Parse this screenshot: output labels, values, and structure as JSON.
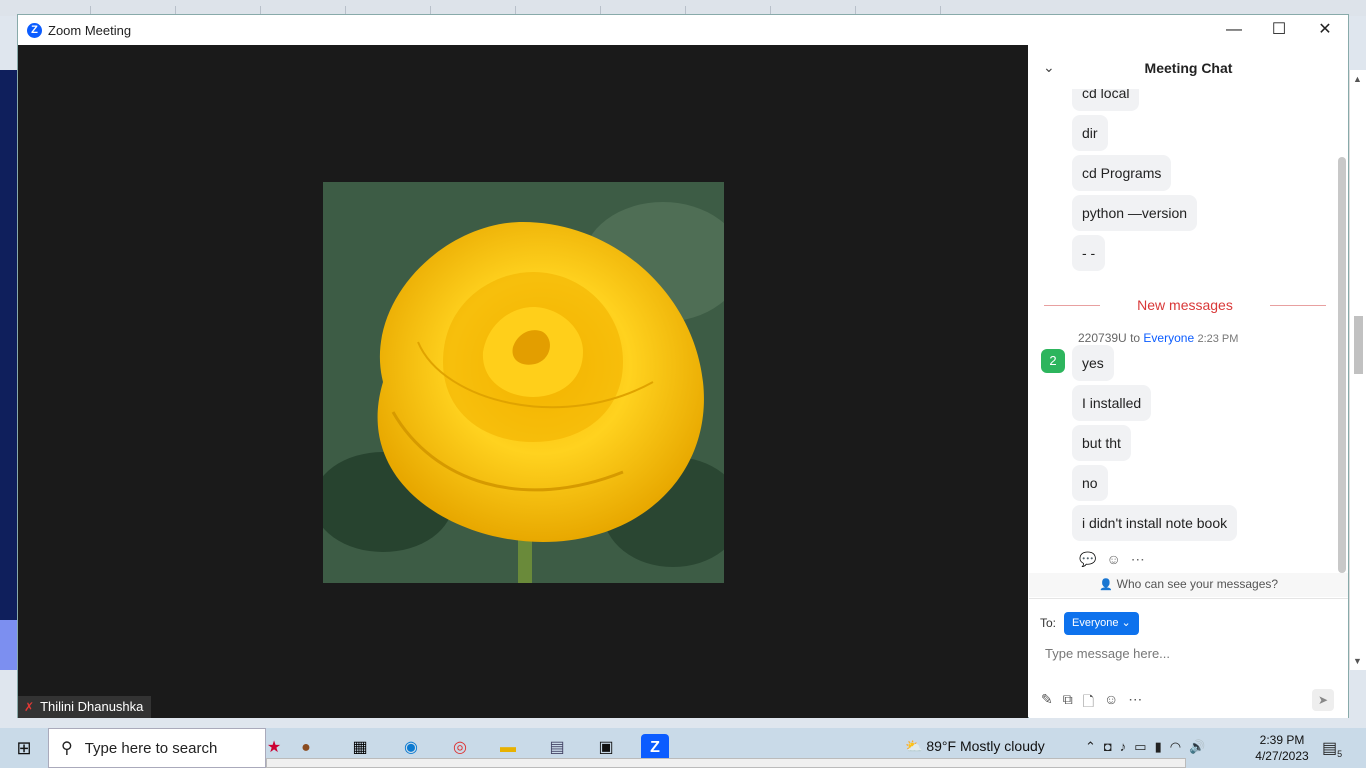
{
  "window": {
    "title": "Zoom Meeting",
    "logo_letter": "Z",
    "minimize": "—",
    "maximize": "☐",
    "close": "✕"
  },
  "video": {
    "participant_name": "Thilini Dhanushka",
    "shared_content": "yellow rose image"
  },
  "chat": {
    "title": "Meeting Chat",
    "earlier_messages": [
      "cd local",
      "dir",
      "cd Programs",
      "python —version",
      "- -"
    ],
    "new_messages_label": "New messages",
    "sender": "220739U",
    "to_word": "to",
    "recipient": "Everyone",
    "time": "2:23 PM",
    "avatar_number": "2",
    "new_messages": [
      "yes",
      "I installed",
      "but tht",
      "no",
      "i didn't install note book"
    ],
    "privacy_text": "Who can see your messages?",
    "to_label": "To:",
    "to_value": "Everyone",
    "input_placeholder": "Type message here..."
  },
  "taskbar": {
    "search_placeholder": "Type here to search",
    "weather_temp": "89°F",
    "weather_desc": "Mostly cloudy",
    "time": "2:39 PM",
    "date": "4/27/2023",
    "notification_count": "5",
    "zoom_letter": "Z"
  },
  "colors": {
    "zoom_blue": "#0b5cff",
    "new_messages_red": "#d93838",
    "avatar_green": "#2db55d",
    "video_bg": "#1a1a1a"
  }
}
